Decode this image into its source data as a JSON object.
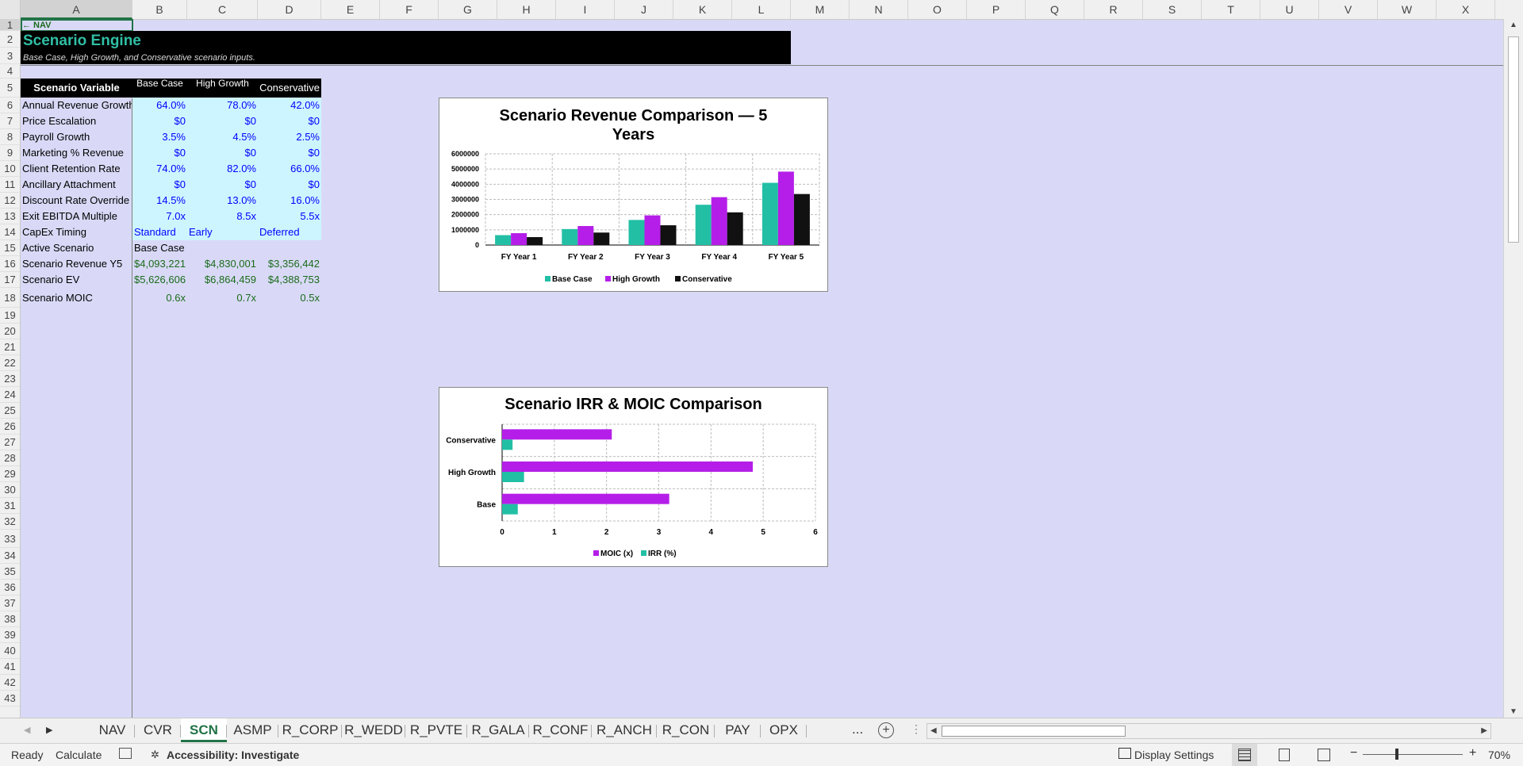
{
  "columns": [
    "A",
    "B",
    "C",
    "D",
    "E",
    "F",
    "G",
    "H",
    "I",
    "J",
    "K",
    "L",
    "M",
    "N",
    "O",
    "P",
    "Q",
    "R",
    "S",
    "T",
    "U",
    "V",
    "W",
    "X"
  ],
  "rows": [
    "1",
    "2",
    "3",
    "4",
    "5",
    "6",
    "7",
    "8",
    "9",
    "10",
    "11",
    "12",
    "13",
    "14",
    "15",
    "16",
    "17",
    "18",
    "19",
    "20",
    "21",
    "22",
    "23",
    "24",
    "25",
    "26",
    "27",
    "28",
    "29",
    "30",
    "31",
    "32",
    "33",
    "34",
    "35",
    "36",
    "37",
    "38",
    "39",
    "40",
    "41",
    "42",
    "43"
  ],
  "sheet": {
    "nav_link": "← NAV",
    "title": "Scenario Engine",
    "subtitle": "Base Case, High Growth, and Conservative scenario inputs.",
    "table": {
      "header_variable": "Scenario Variable",
      "header_base": "Base Case",
      "header_high": "High Growth",
      "header_cons": "Conservative",
      "rows": [
        {
          "label": "Annual Revenue Growth",
          "b": "64.0%",
          "c": "78.0%",
          "d": "42.0%"
        },
        {
          "label": "Price Escalation",
          "b": "$0",
          "c": "$0",
          "d": "$0"
        },
        {
          "label": "Payroll Growth",
          "b": "3.5%",
          "c": "4.5%",
          "d": "2.5%"
        },
        {
          "label": "Marketing % Revenue",
          "b": "$0",
          "c": "$0",
          "d": "$0"
        },
        {
          "label": "Client Retention Rate",
          "b": "74.0%",
          "c": "82.0%",
          "d": "66.0%"
        },
        {
          "label": "Ancillary Attachment",
          "b": "$0",
          "c": "$0",
          "d": "$0"
        },
        {
          "label": "Discount Rate Override",
          "b": "14.5%",
          "c": "13.0%",
          "d": "16.0%"
        },
        {
          "label": "Exit EBITDA Multiple",
          "b": "7.0x",
          "c": "8.5x",
          "d": "5.5x"
        },
        {
          "label": "CapEx Timing",
          "b": "Standard",
          "c": "Early",
          "d": "Deferred"
        }
      ],
      "active_label": "Active Scenario",
      "active_value": "Base Case",
      "rev_label": "Scenario Revenue Y5",
      "rev": {
        "b": "$4,093,221",
        "c": "$4,830,001",
        "d": "$3,356,442"
      },
      "ev_label": "Scenario EV",
      "ev": {
        "b": "$5,626,606",
        "c": "$6,864,459",
        "d": "$4,388,753"
      },
      "moic_label": "Scenario MOIC",
      "moic": {
        "b": "0.6x",
        "c": "0.7x",
        "d": "0.5x"
      }
    }
  },
  "colors": {
    "base": "#22bfa5",
    "high": "#b51ee8",
    "cons": "#111111",
    "input_bg": "#ccf5ff",
    "input_text": "#0000ff",
    "output_text": "#1a6b1a"
  },
  "chart_data": [
    {
      "type": "bar",
      "title": "Scenario Revenue Comparison — 5 Years",
      "categories": [
        "FY Year 1",
        "FY Year 2",
        "FY Year 3",
        "FY Year 4",
        "FY Year 5"
      ],
      "ylim": [
        0,
        6000000
      ],
      "yticks": [
        "0",
        "1000000",
        "2000000",
        "3000000",
        "4000000",
        "5000000",
        "6000000"
      ],
      "grid": true,
      "legend": "bottom",
      "series": [
        {
          "name": "Base Case",
          "values": [
            650000,
            1050000,
            1650000,
            2650000,
            4093221
          ]
        },
        {
          "name": "High Growth",
          "values": [
            780000,
            1250000,
            1950000,
            3150000,
            4830001
          ]
        },
        {
          "name": "Conservative",
          "values": [
            520000,
            820000,
            1300000,
            2150000,
            3356442
          ]
        }
      ]
    },
    {
      "type": "bar",
      "orientation": "horizontal",
      "title": "Scenario IRR & MOIC Comparison",
      "categories": [
        "Base",
        "High Growth",
        "Conservative"
      ],
      "xlim": [
        0,
        6
      ],
      "xticks": [
        "0",
        "1",
        "2",
        "3",
        "4",
        "5",
        "6"
      ],
      "grid": true,
      "legend": "bottom",
      "series": [
        {
          "name": "MOIC (x)",
          "values": [
            3.2,
            4.8,
            2.1
          ]
        },
        {
          "name": "IRR (%)",
          "values": [
            0.3,
            0.42,
            0.2
          ]
        }
      ]
    }
  ],
  "tabs": [
    "NAV",
    "CVR",
    "SCN",
    "ASMP",
    "R_CORP",
    "R_WEDD",
    "R_PVTE",
    "R_GALA",
    "R_CONF",
    "R_ANCH",
    "R_CON",
    "PAY",
    "OPX"
  ],
  "active_tab": "SCN",
  "tab_more": "...",
  "status": {
    "ready": "Ready",
    "calculate": "Calculate",
    "accessibility": "Accessibility: Investigate",
    "display_settings": "Display Settings",
    "zoom": "70%"
  }
}
